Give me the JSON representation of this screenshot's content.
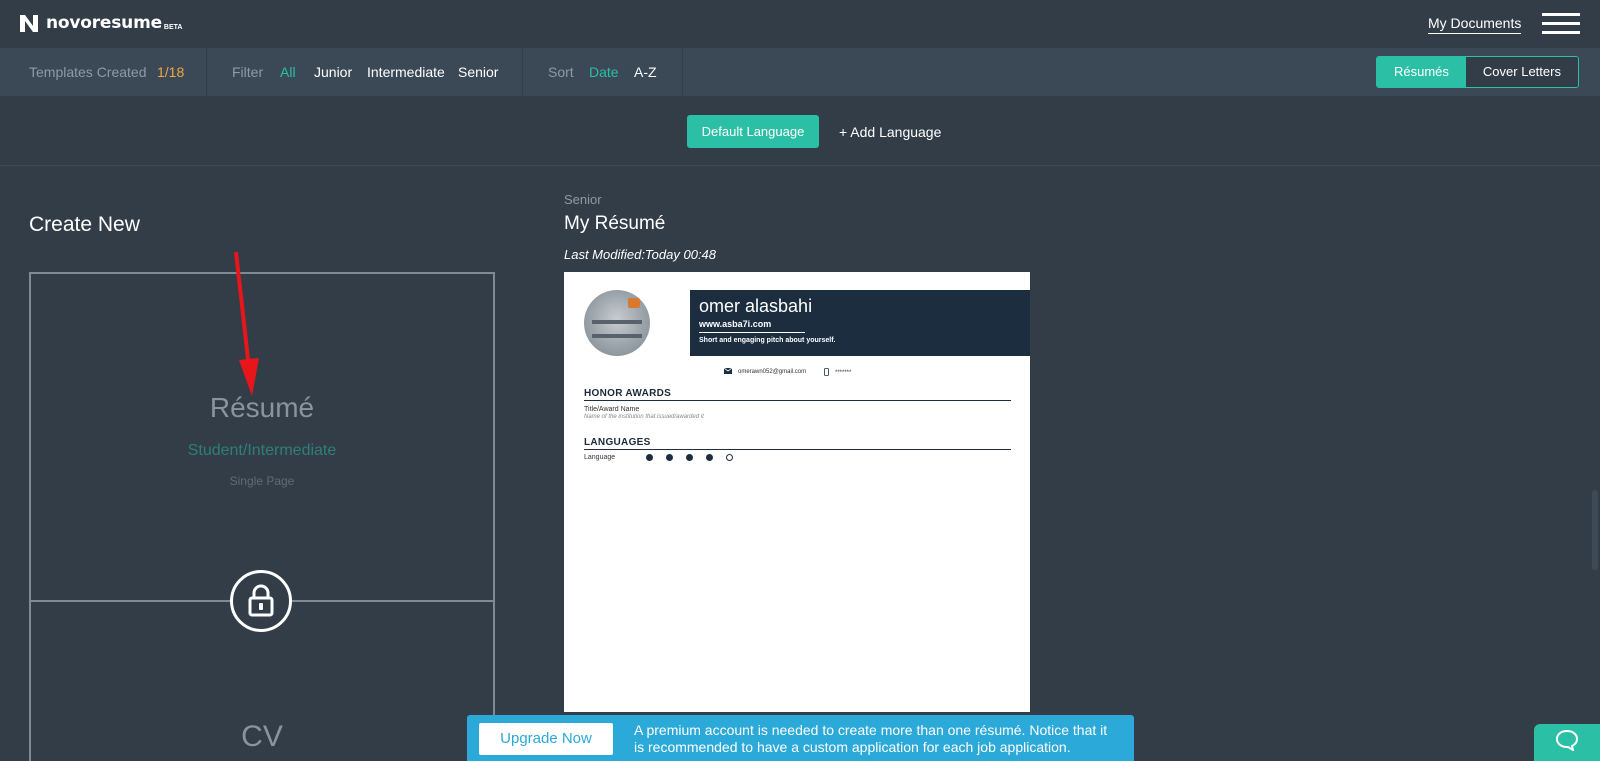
{
  "header": {
    "logo_text": "novoresume",
    "logo_badge": "BETA",
    "my_documents": "My Documents"
  },
  "filterbar": {
    "templates_label": "Templates Created",
    "templates_count": "1/18",
    "filter_label": "Filter",
    "filters": [
      "All",
      "Junior",
      "Intermediate",
      "Senior"
    ],
    "sort_label": "Sort",
    "sorts": [
      "Date",
      "A-Z"
    ],
    "toggle": [
      "Résumés",
      "Cover Letters"
    ]
  },
  "language": {
    "default_button": "Default Language",
    "add_button": "+ Add Language"
  },
  "create": {
    "title": "Create New",
    "resume_title": "Résumé",
    "resume_sub": "Student/Intermediate",
    "resume_pages": "Single Page",
    "cv_title": "CV"
  },
  "document": {
    "level": "Senior",
    "title": "My Résumé",
    "last_modified": "Last Modified:Today 00:48",
    "preview": {
      "name": "omer alasbahi",
      "website": "www.asba7i.com",
      "pitch": "Short and engaging pitch about yourself.",
      "email": "omerawn052@gmail.com",
      "phone": "*******",
      "section_awards": "HONOR AWARDS",
      "award_title": "Title/Award Name",
      "award_sub": "Name of the institution that issued/awarded it",
      "section_languages": "LANGUAGES",
      "language_name": "Language",
      "language_level": 4,
      "language_max": 5
    }
  },
  "banner": {
    "button": "Upgrade Now",
    "text": "A premium account is needed to create more than one résumé. Notice that it is recommended to have a custom application for each job application."
  },
  "colors": {
    "background": "#323d48",
    "accent": "#2bbfa6",
    "banner": "#2ba9d9",
    "templates_count": "#f3a640"
  }
}
